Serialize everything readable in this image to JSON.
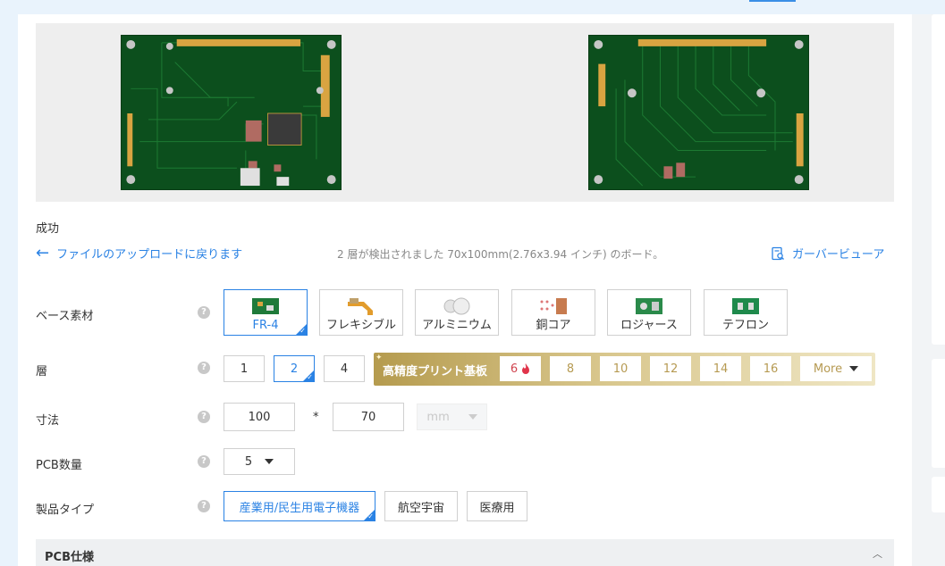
{
  "status": {
    "text": "成功"
  },
  "nav": {
    "back_label": "ファイルのアップロードに戻ります",
    "detection_text": "2 層が検出されました 70x100mm(2.76x3.94 インチ) のボード。",
    "gerber_viewer_label": "ガーバービューア"
  },
  "base_material": {
    "label": "ベース素材",
    "options": [
      "FR-4",
      "フレキシブル",
      "アルミニウム",
      "銅コア",
      "ロジャース",
      "テフロン"
    ],
    "selected": "FR-4"
  },
  "layers": {
    "label": "層",
    "options": [
      "1",
      "2",
      "4"
    ],
    "selected": "2",
    "high_density": {
      "title": "高精度プリント基板",
      "options": [
        "6",
        "8",
        "10",
        "12",
        "14",
        "16"
      ],
      "more_label": "More"
    }
  },
  "dimensions": {
    "label": "寸法",
    "width": "100",
    "separator": "*",
    "height": "70",
    "unit": "mm"
  },
  "pcb_quantity": {
    "label": "PCB数量",
    "value": "5"
  },
  "product_type": {
    "label": "製品タイプ",
    "options": [
      "産業用/民生用電子機器",
      "航空宇宙",
      "医療用"
    ],
    "selected": "産業用/民生用電子機器"
  },
  "pcb_spec": {
    "title": "PCB仕様"
  },
  "colors": {
    "accent": "#2a82e4",
    "pcb_green": "#0c4f1d",
    "gold": "#b59b4e"
  }
}
